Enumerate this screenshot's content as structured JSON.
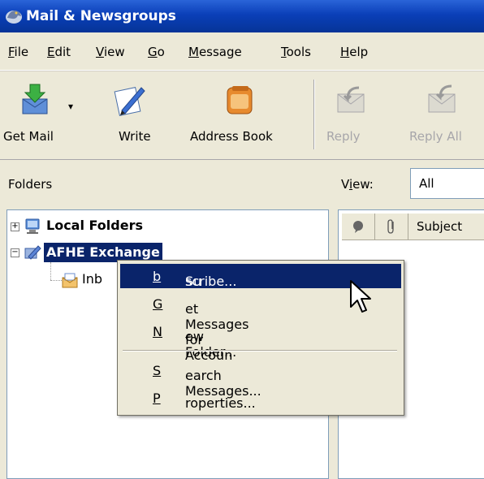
{
  "window": {
    "title": "Mail & Newsgroups"
  },
  "menubar": {
    "items": [
      {
        "pre": "",
        "u": "F",
        "post": "ile"
      },
      {
        "pre": "",
        "u": "E",
        "post": "dit"
      },
      {
        "pre": "",
        "u": "V",
        "post": "iew"
      },
      {
        "pre": "",
        "u": "G",
        "post": "o"
      },
      {
        "pre": "",
        "u": "M",
        "post": "essage"
      },
      {
        "pre": "",
        "u": "T",
        "post": "ools"
      },
      {
        "pre": "",
        "u": "H",
        "post": "elp"
      }
    ]
  },
  "toolbar": {
    "get_mail": "Get Mail",
    "write": "Write",
    "address_book": "Address Book",
    "reply": "Reply",
    "reply_all": "Reply All"
  },
  "folders": {
    "header": "Folders",
    "tree": [
      {
        "label": "Local Folders",
        "expander": "+"
      },
      {
        "label": "AFHE Exchange",
        "expander": "−"
      },
      {
        "label": "Inb"
      }
    ]
  },
  "thread_pane": {
    "view_label_pre": "V",
    "view_label_u": "i",
    "view_label_post": "ew:",
    "view_value": "All",
    "columns": [
      "Subject"
    ]
  },
  "context_menu": {
    "items": [
      {
        "pre": "Su",
        "u": "b",
        "post": "scribe..."
      },
      {
        "pre": "",
        "u": "G",
        "post": "et Messages for Accoun"
      },
      {
        "pre": "",
        "u": "N",
        "post": "ew Folder..."
      },
      {
        "pre": "",
        "u": "S",
        "post": "earch Messages..."
      },
      {
        "pre": "",
        "u": "P",
        "post": "roperties..."
      }
    ]
  },
  "colors": {
    "titlebar": "#0a3fb8",
    "selection": "#0a246a",
    "chrome": "#ece9d8"
  }
}
